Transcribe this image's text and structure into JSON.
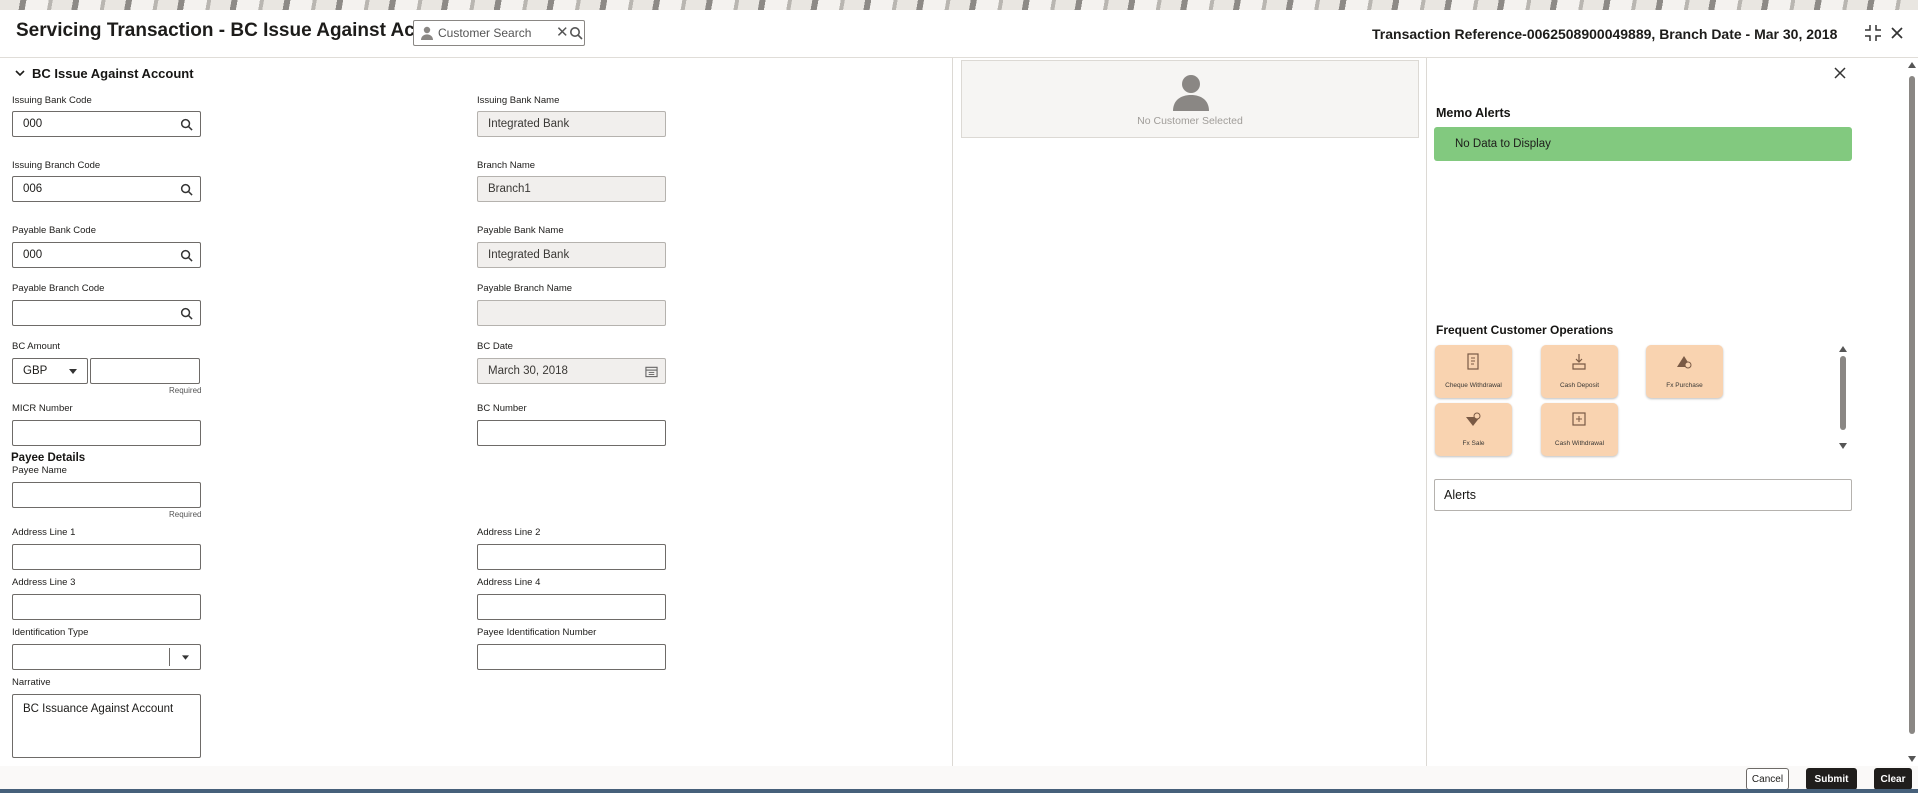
{
  "header": {
    "title": "Servicing Transaction - BC Issue Against Account",
    "customer_search_placeholder": "Customer Search",
    "transaction_info": "Transaction Reference-0062508900049889, Branch Date - Mar 30, 2018"
  },
  "form": {
    "section_title": "BC Issue Against Account",
    "issuing_bank_code": {
      "label": "Issuing Bank Code",
      "value": "000"
    },
    "issuing_bank_name": {
      "label": "Issuing Bank Name",
      "value": "Integrated Bank"
    },
    "issuing_branch_code": {
      "label": "Issuing Branch Code",
      "value": "006"
    },
    "branch_name": {
      "label": "Branch Name",
      "value": "Branch1"
    },
    "payable_bank_code": {
      "label": "Payable Bank Code",
      "value": "000"
    },
    "payable_bank_name": {
      "label": "Payable Bank Name",
      "value": "Integrated Bank"
    },
    "payable_branch_code": {
      "label": "Payable Branch Code",
      "value": ""
    },
    "payable_branch_name": {
      "label": "Payable Branch Name",
      "value": ""
    },
    "bc_amount": {
      "label": "BC Amount",
      "currency": "GBP",
      "value": "",
      "required": "Required"
    },
    "bc_date": {
      "label": "BC Date",
      "value": "March 30, 2018"
    },
    "micr_number": {
      "label": "MICR Number",
      "value": ""
    },
    "bc_number": {
      "label": "BC Number",
      "value": ""
    },
    "payee_details_heading": "Payee Details",
    "payee_name": {
      "label": "Payee Name",
      "value": "",
      "required": "Required"
    },
    "address_line_1": {
      "label": "Address Line 1",
      "value": ""
    },
    "address_line_2": {
      "label": "Address Line 2",
      "value": ""
    },
    "address_line_3": {
      "label": "Address Line 3",
      "value": ""
    },
    "address_line_4": {
      "label": "Address Line 4",
      "value": ""
    },
    "identification_type": {
      "label": "Identification Type",
      "value": ""
    },
    "payee_identification_number": {
      "label": "Payee Identification Number",
      "value": ""
    },
    "narrative": {
      "label": "Narrative",
      "value": "BC Issuance Against Account"
    }
  },
  "customer_panel": {
    "no_customer_text": "No Customer Selected"
  },
  "side_panel": {
    "memo_alerts_title": "Memo Alerts",
    "memo_alerts_empty": "No Data to Display",
    "frequent_ops_title": "Frequent Customer Operations",
    "operations": [
      {
        "label": "Cheque Withdrawal",
        "icon": "cheque-icon"
      },
      {
        "label": "Cash Deposit",
        "icon": "cash-deposit-icon"
      },
      {
        "label": "Fx Purchase",
        "icon": "fx-purchase-icon"
      },
      {
        "label": "Fx Sale",
        "icon": "fx-sale-icon"
      },
      {
        "label": "Cash Withdrawal",
        "icon": "cash-withdrawal-icon"
      }
    ],
    "alerts_label": "Alerts"
  },
  "footer": {
    "cancel_label": "Cancel",
    "submit_label": "Submit",
    "clear_label": "Clear"
  },
  "colors": {
    "memo_empty_bg": "#82c97f",
    "operation_tile_bg": "#f9d3b0",
    "primary_button_bg": "#201e1c"
  }
}
